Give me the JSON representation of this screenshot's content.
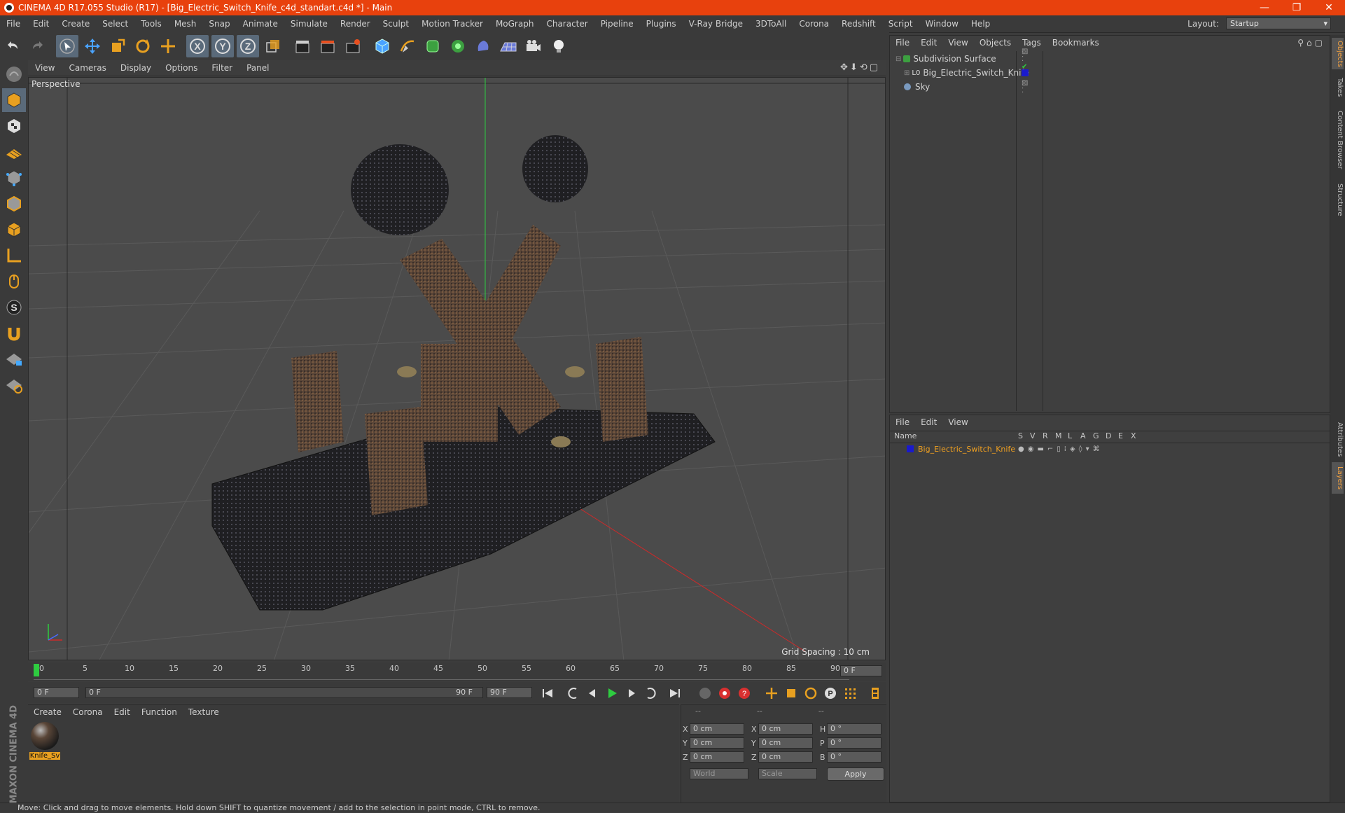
{
  "window": {
    "title": "CINEMA 4D R17.055 Studio (R17) - [Big_Electric_Switch_Knife_c4d_standart.c4d *] - Main",
    "controls": [
      "—",
      "❐",
      "✕"
    ]
  },
  "menubar": {
    "items": [
      "File",
      "Edit",
      "Create",
      "Select",
      "Tools",
      "Mesh",
      "Snap",
      "Animate",
      "Simulate",
      "Render",
      "Sculpt",
      "Motion Tracker",
      "MoGraph",
      "Character",
      "Pipeline",
      "Plugins",
      "V-Ray Bridge",
      "3DToAll",
      "Corona",
      "Redshift",
      "Script",
      "Window",
      "Help"
    ],
    "layout_label": "Layout:",
    "layout_value": "Startup"
  },
  "viewport": {
    "menu": [
      "View",
      "Cameras",
      "Display",
      "Options",
      "Filter",
      "Panel"
    ],
    "label": "Perspective",
    "grid_spacing": "Grid Spacing : 10 cm"
  },
  "timeline": {
    "ticks": [
      "0",
      "5",
      "10",
      "15",
      "20",
      "25",
      "30",
      "35",
      "40",
      "45",
      "50",
      "55",
      "60",
      "65",
      "70",
      "75",
      "80",
      "85",
      "90"
    ],
    "current_frame": "0 F"
  },
  "playbar": {
    "start_field": "0 F",
    "range_start": "0 F",
    "range_end": "90 F",
    "end_field": "90 F"
  },
  "material_panel": {
    "menu": [
      "Create",
      "Corona",
      "Edit",
      "Function",
      "Texture"
    ],
    "material_name": "Knife_Sv"
  },
  "coordinates": {
    "headers": [
      "--",
      "--",
      "--"
    ],
    "rows": [
      {
        "axis1": "X",
        "val1": "0 cm",
        "axis2": "X",
        "val2": "0 cm",
        "axis3": "H",
        "val3": "0 °"
      },
      {
        "axis1": "Y",
        "val1": "0 cm",
        "axis2": "Y",
        "val2": "0 cm",
        "axis3": "P",
        "val3": "0 °"
      },
      {
        "axis1": "Z",
        "val1": "0 cm",
        "axis2": "Z",
        "val2": "0 cm",
        "axis3": "B",
        "val3": "0 °"
      }
    ],
    "space": "World",
    "mode": "Scale",
    "apply": "Apply"
  },
  "object_manager": {
    "menu": [
      "File",
      "Edit",
      "View",
      "Objects",
      "Tags",
      "Bookmarks"
    ],
    "objects": [
      {
        "name": "Subdivision Surface"
      },
      {
        "name": "Big_Electric_Switch_Knife"
      },
      {
        "name": "Sky"
      }
    ]
  },
  "layer_manager": {
    "menu": [
      "File",
      "Edit",
      "View"
    ],
    "name_header": "Name",
    "columns": [
      "S",
      "V",
      "R",
      "M",
      "L",
      "A",
      "G",
      "D",
      "E",
      "X"
    ],
    "layers": [
      {
        "name": "Big_Electric_Switch_Knife",
        "color": "#1a1acc"
      }
    ]
  },
  "right_tabs": [
    "Objects",
    "Takes",
    "Content Browser",
    "Structure",
    "Attributes",
    "Layers"
  ],
  "status": "Move: Click and drag to move elements. Hold down SHIFT to quantize movement / add to the selection in point mode, CTRL to remove.",
  "branding": "MAXON CINEMA 4D",
  "colors": {
    "accent": "#e8410d",
    "active_text": "#f0a020",
    "timeline_cursor": "#2ecc40"
  }
}
